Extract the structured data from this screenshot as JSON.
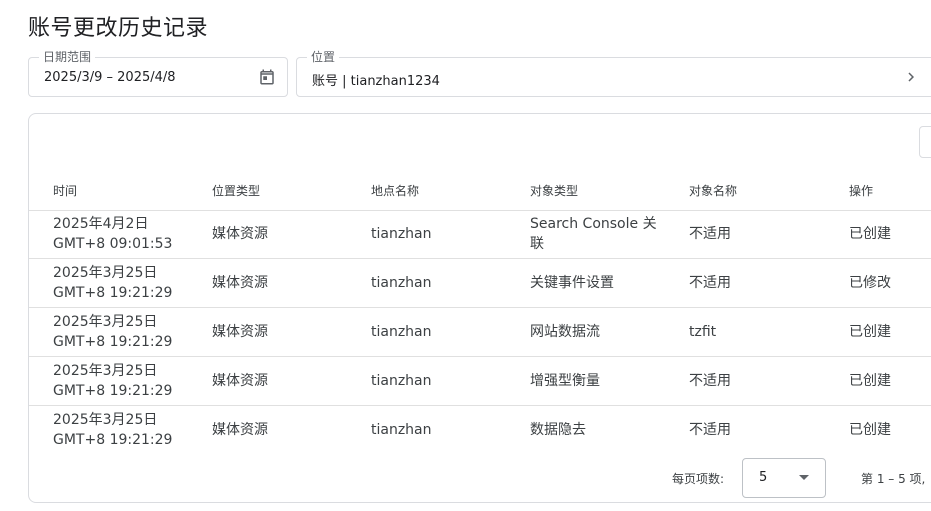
{
  "page": {
    "title": "账号更改历史记录"
  },
  "filters": {
    "date_range": {
      "label": "日期范围",
      "value": "2025/3/9 – 2025/4/8"
    },
    "location": {
      "label": "位置",
      "value": "账号 | tianzhan1234"
    }
  },
  "table": {
    "headers": {
      "time": "时间",
      "location_type": "位置类型",
      "location_name": "地点名称",
      "object_type": "对象类型",
      "object_name": "对象名称",
      "action": "操作"
    },
    "rows": [
      {
        "date": "2025年4月2日",
        "time": "GMT+8 09:01:53",
        "location_type": "媒体资源",
        "location_name": "tianzhan",
        "object_type": "Search Console 关联",
        "object_name": "不适用",
        "action": "已创建"
      },
      {
        "date": "2025年3月25日",
        "time": "GMT+8 19:21:29",
        "location_type": "媒体资源",
        "location_name": "tianzhan",
        "object_type": "关键事件设置",
        "object_name": "不适用",
        "action": "已修改"
      },
      {
        "date": "2025年3月25日",
        "time": "GMT+8 19:21:29",
        "location_type": "媒体资源",
        "location_name": "tianzhan",
        "object_type": "网站数据流",
        "object_name": "tzfit",
        "action": "已创建"
      },
      {
        "date": "2025年3月25日",
        "time": "GMT+8 19:21:29",
        "location_type": "媒体资源",
        "location_name": "tianzhan",
        "object_type": "增强型衡量",
        "object_name": "不适用",
        "action": "已创建"
      },
      {
        "date": "2025年3月25日",
        "time": "GMT+8 19:21:29",
        "location_type": "媒体资源",
        "location_name": "tianzhan",
        "object_type": "数据隐去",
        "object_name": "不适用",
        "action": "已创建"
      }
    ]
  },
  "pagination": {
    "label": "每页项数:",
    "page_size": "5",
    "range": "第 1 – 5 项,"
  },
  "icons": {
    "calendar": "calendar-icon",
    "chevron": "chevron-right-icon",
    "dropdown": "dropdown-arrow-icon"
  }
}
